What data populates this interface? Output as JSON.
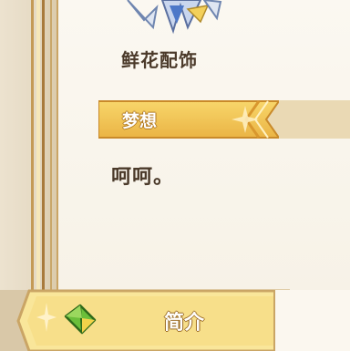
{
  "item": {
    "name": "鲜花配饰",
    "portrait_icon": "flower-accessory-icon"
  },
  "section": {
    "title": "梦想",
    "sparkle_icon": "sparkle-icon"
  },
  "description": "呵呵。",
  "tabs": {
    "active_label": "简介",
    "active_icon": "leaf-icon"
  },
  "colors": {
    "ribbon": "#f3c24a",
    "ribbon_dark": "#c98a2a",
    "tab": "#f7df8a",
    "text_dark": "#4b3a2a",
    "leaf": "#6bbf3a"
  }
}
